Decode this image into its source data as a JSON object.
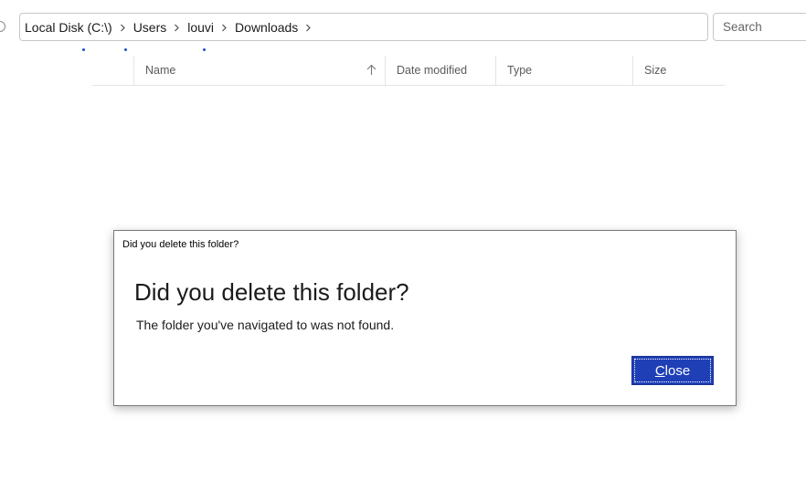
{
  "address_bar": {
    "crumbs": [
      "Local Disk (C:\\)",
      "Users",
      "louvi",
      "Downloads"
    ]
  },
  "search": {
    "placeholder": "Search"
  },
  "columns": {
    "name": "Name",
    "date_modified": "Date modified",
    "type": "Type",
    "size": "Size",
    "sort_icon": "arrow-up-icon"
  },
  "dialog": {
    "title": "Did you delete this folder?",
    "heading": "Did you delete this folder?",
    "message": "The folder you've navigated to was not found.",
    "close_label_accel": "C",
    "close_label_rest": "lose"
  },
  "colors": {
    "accent": "#1f3fb7",
    "dots": "#1f4fc9"
  }
}
